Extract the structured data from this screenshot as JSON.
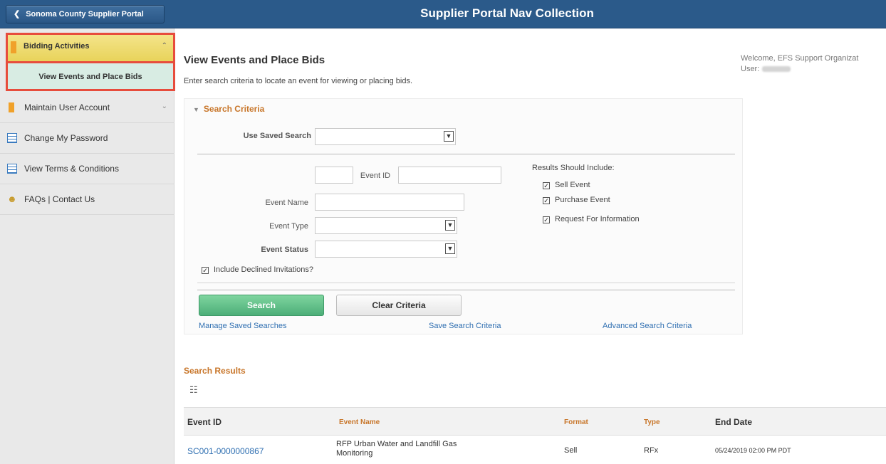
{
  "header": {
    "back_label": "Sonoma County Supplier Portal",
    "title": "Supplier Portal Nav Collection"
  },
  "sidebar": {
    "group": {
      "label": "Bidding Activities",
      "icon": "folder-icon"
    },
    "active_item": "View Events and Place Bids",
    "items": [
      {
        "label": "Maintain User Account",
        "icon": "folder-icon"
      },
      {
        "label": "Change My Password",
        "icon": "table-icon"
      },
      {
        "label": "View Terms & Conditions",
        "icon": "table-icon"
      },
      {
        "label": "FAQs | Contact Us",
        "icon": "people-icon"
      }
    ]
  },
  "page": {
    "title": "View Events and Place Bids",
    "description": "Enter search criteria to locate an event for viewing or placing bids.",
    "welcome": "Welcome, EFS Support Organizat",
    "user_label": "User:"
  },
  "search": {
    "section_title": "Search Criteria",
    "saved_search_label": "Use Saved Search",
    "event_id_label": "Event ID",
    "event_name_label": "Event Name",
    "event_type_label": "Event Type",
    "event_status_label": "Event Status",
    "include_declined_label": "Include Declined Invitations?",
    "results_include_label": "Results Should Include:",
    "include_options": [
      {
        "label": "Sell Event",
        "checked": true
      },
      {
        "label": "Purchase Event",
        "checked": true
      },
      {
        "label": "Request For Information",
        "checked": true
      }
    ],
    "search_button": "Search",
    "clear_button": "Clear Criteria",
    "manage_link": "Manage Saved Searches",
    "save_link": "Save Search Criteria",
    "advanced_link": "Advanced Search Criteria"
  },
  "results": {
    "title": "Search Results",
    "columns": [
      "Event ID",
      "Event Name",
      "Format",
      "Type",
      "End Date"
    ],
    "rows": [
      {
        "event_id": "SC001-0000000867",
        "event_name": "RFP Urban Water and Landfill Gas Monitoring",
        "format": "Sell",
        "type": "RFx",
        "end_date": "05/24/2019 02:00 PM PDT"
      }
    ]
  },
  "colors": {
    "header_bg": "#2b5a8a",
    "accent_orange": "#c8762a",
    "search_button": "#4cae78",
    "link_blue": "#2f6fb1",
    "highlight_border": "#e74c3c"
  }
}
